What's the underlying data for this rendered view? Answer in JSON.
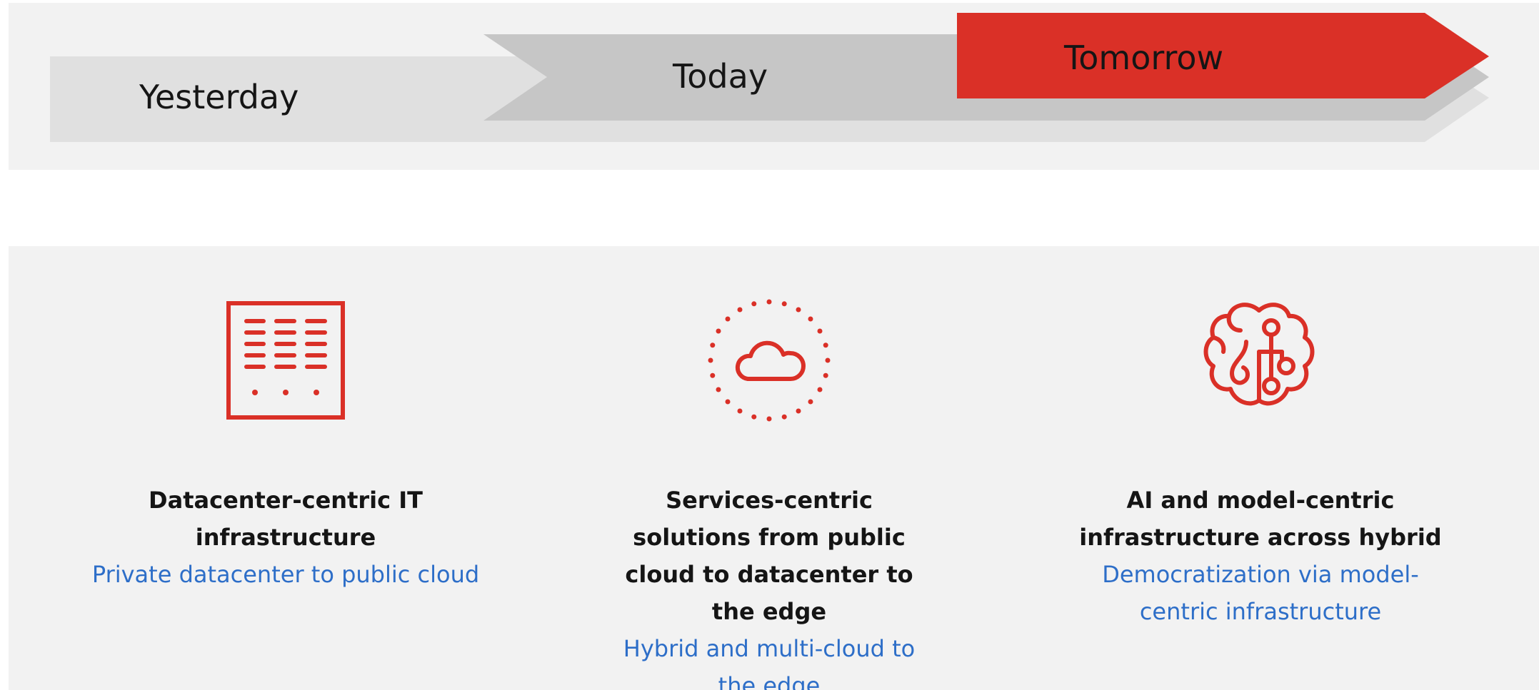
{
  "timeline": {
    "stages": [
      {
        "label": "Yesterday"
      },
      {
        "label": "Today"
      },
      {
        "label": "Tomorrow"
      }
    ],
    "colors": {
      "yesterday": "#e0e0e0",
      "today": "#c6c6c6",
      "tomorrow": "#da3027"
    }
  },
  "columns": [
    {
      "icon": "server-rack-icon",
      "title": "Datacenter-centric IT infrastructure",
      "subtitle": "Private datacenter to public cloud"
    },
    {
      "icon": "cloud-icon",
      "title": "Services-centric solutions from public cloud to datacenter to the edge",
      "subtitle": "Hybrid and multi-cloud to the edge"
    },
    {
      "icon": "ai-brain-icon",
      "title": "AI and model-centric infrastructure across hybrid",
      "subtitle": "Democratization via model-centric infrastructure"
    }
  ],
  "colors": {
    "accent": "#da3027",
    "title_text": "#151515",
    "subtitle_text": "#2d6ec8",
    "band_background": "#f2f2f2"
  }
}
